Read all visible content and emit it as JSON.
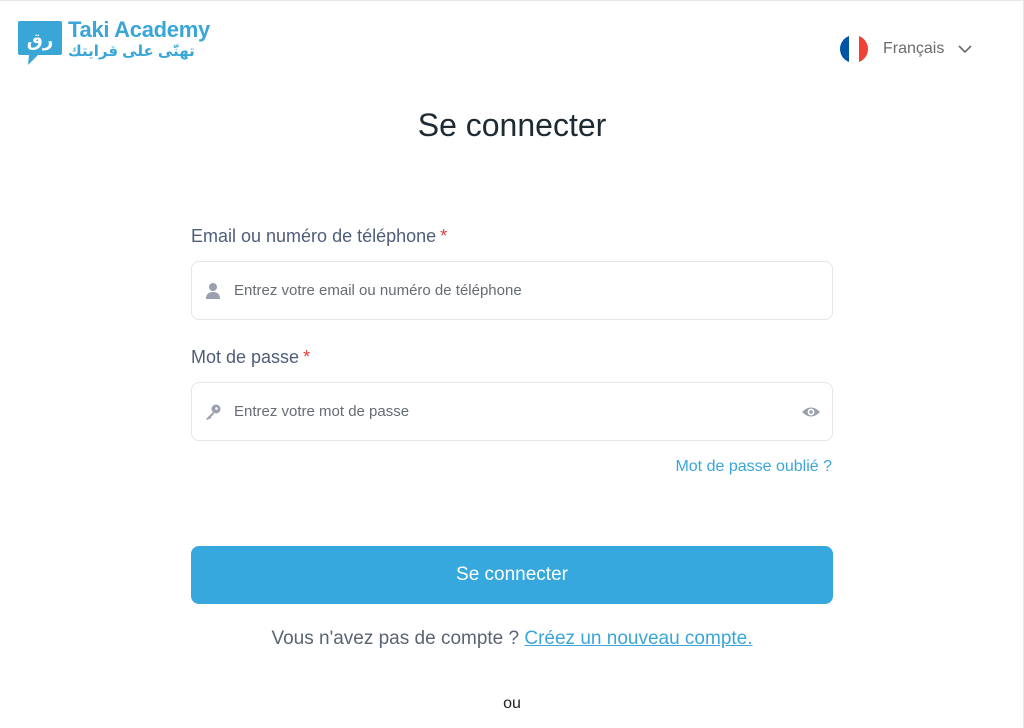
{
  "logo": {
    "name": "Taki Academy",
    "tagline": "تهنّى على قرايتك",
    "glyph": "رق"
  },
  "language": {
    "selected": "Français",
    "flag_colors": [
      "#0055a4",
      "#ffffff",
      "#ef4135"
    ]
  },
  "title": "Se connecter",
  "form": {
    "identifier": {
      "label": "Email ou numéro de téléphone",
      "required_mark": "*",
      "placeholder": "Entrez votre email ou numéro de téléphone",
      "value": "",
      "icon": "user-icon"
    },
    "password": {
      "label": "Mot de passe",
      "required_mark": "*",
      "placeholder": "Entrez votre mot de passe",
      "value": "",
      "icon": "key-icon",
      "toggle_icon": "eye-icon"
    },
    "forgot_label": "Mot de passe oublié ?",
    "submit_label": "Se connecter"
  },
  "signup": {
    "prompt": "Vous n'avez pas de compte ?",
    "link_label": "Créez un nouveau compte."
  },
  "divider_text": "ou",
  "colors": {
    "accent": "#36a8de",
    "required": "#e23b3b",
    "label": "#4f5d7a"
  }
}
